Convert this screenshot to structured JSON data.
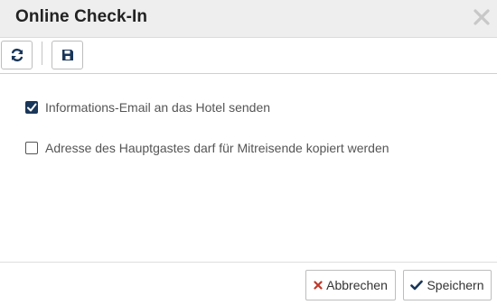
{
  "dialog": {
    "title": "Online Check-In",
    "close_icon": "close-icon"
  },
  "toolbar": {
    "buttons": [
      {
        "icon": "refresh-icon"
      },
      {
        "icon": "save-icon"
      }
    ]
  },
  "options": [
    {
      "label": "Informations-Email an das Hotel senden",
      "checked": true
    },
    {
      "label": "Adresse des Hauptgastes darf für Mitreisende kopiert werden",
      "checked": false
    }
  ],
  "footer": {
    "cancel_label": "Abbrechen",
    "save_label": "Speichern"
  },
  "colors": {
    "accent": "#1a3659",
    "cancel_icon": "#c0392b",
    "titlebar_bg": "#eeeeee"
  }
}
